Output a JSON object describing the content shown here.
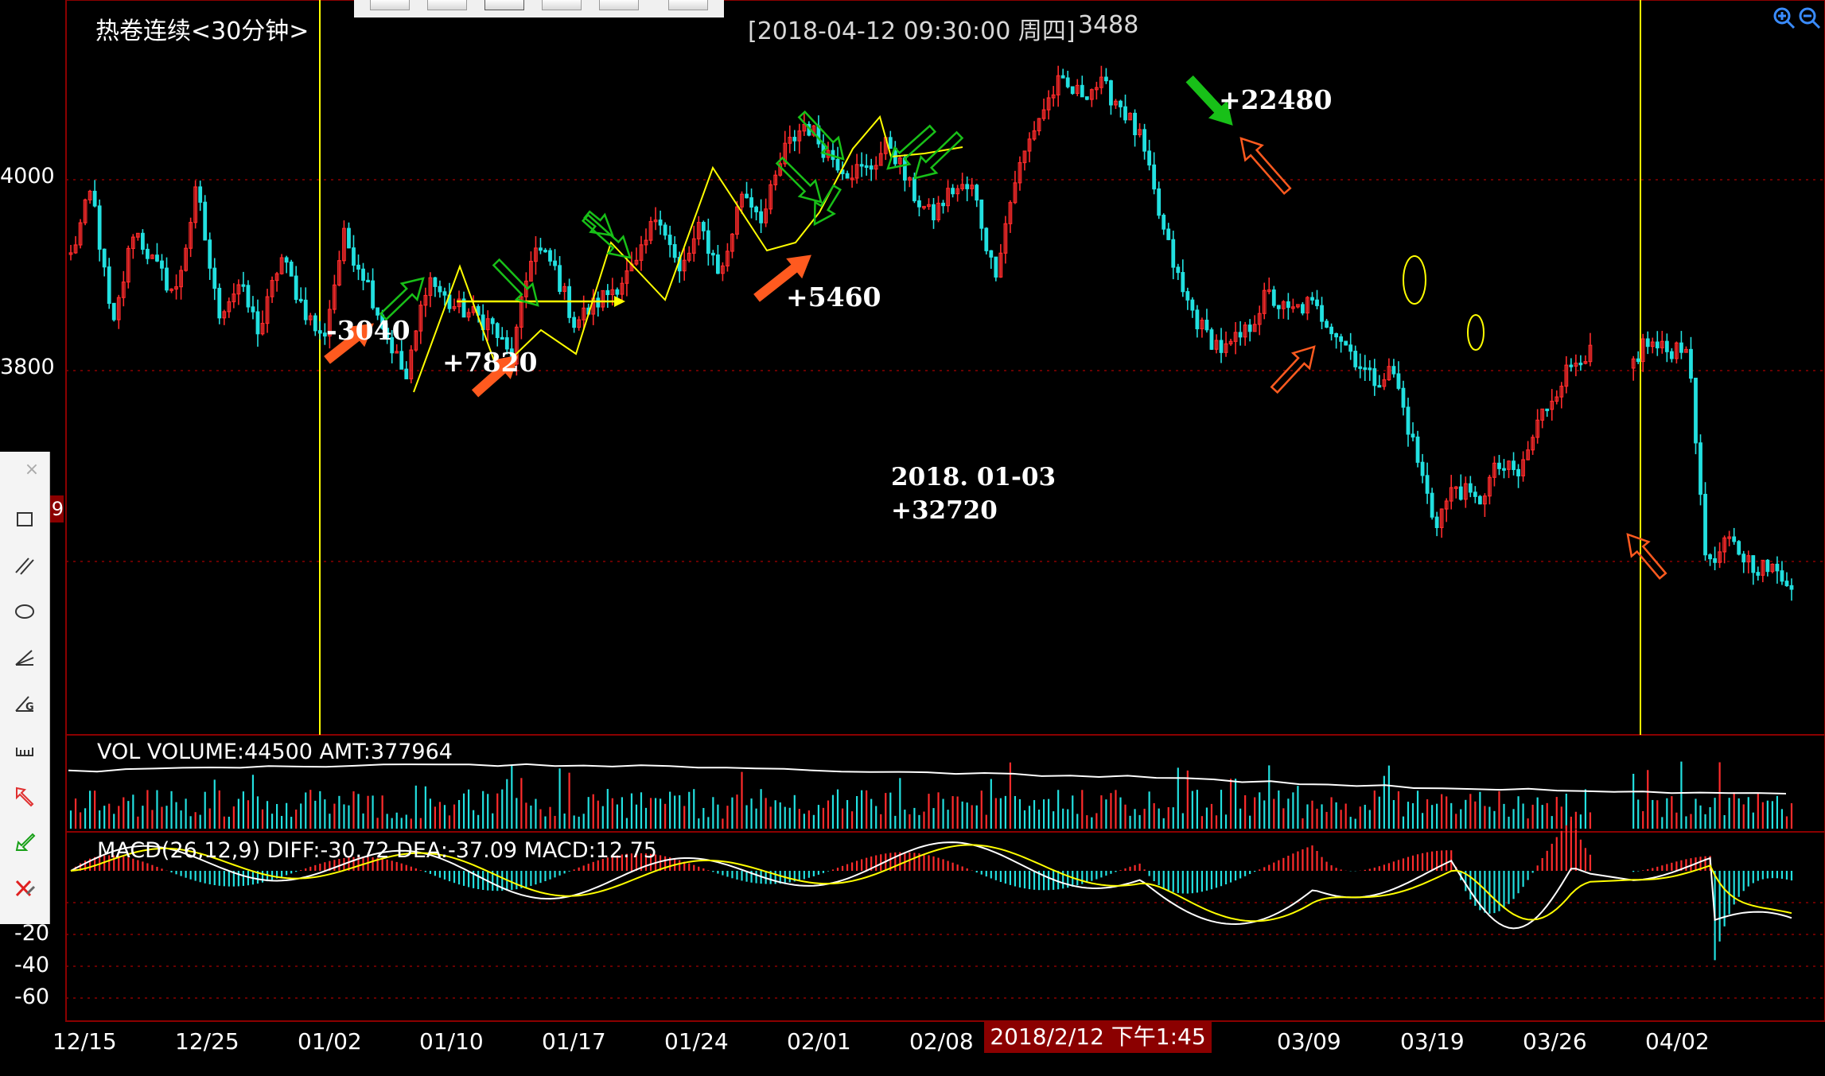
{
  "header": {
    "title": "热卷连续<30分钟>",
    "datetime": "[2018-04-12  09:30:00 周四]",
    "price": "3488"
  },
  "y_axis": {
    "main_ticks": [
      "4000",
      "3800"
    ],
    "macd_ticks": [
      "-20",
      "-40",
      "-60"
    ]
  },
  "x_axis": {
    "ticks": [
      "12/15",
      "12/25",
      "01/02",
      "01/10",
      "01/17",
      "01/24",
      "02/01",
      "02/08",
      "03/09",
      "03/19",
      "03/26",
      "04/02"
    ]
  },
  "crosshair_date": "2018/2/12 下午1:45",
  "vol_label": "VOL  VOLUME:44500 AMT:377964",
  "macd_label": "MACD(26,12,9)  DIFF:-30.72 DEA:-37.09 MACD:12.75",
  "annotations": {
    "a1": "-3040",
    "a2": "+7820",
    "a3": "+5460",
    "a4": "+22480",
    "note_date": "2018. 01-03",
    "note_total": "+32720"
  },
  "toolbox": {
    "close_label": "×",
    "side_value": "9"
  },
  "colors": {
    "up": "#ff2b2b",
    "down": "#22e0e0",
    "grid": "#8b0000",
    "yellow": "#ffff00",
    "green": "#18c018",
    "orange": "#ff5a1f"
  },
  "chart_data": {
    "type": "candlestick",
    "title": "热卷连续<30分钟>",
    "ylim": [
      3560,
      4170
    ],
    "x_ticks": [
      "12/15",
      "12/25",
      "01/02",
      "01/10",
      "01/17",
      "01/24",
      "02/01",
      "02/08",
      "03/09",
      "03/19",
      "03/26",
      "04/02"
    ],
    "price_path": [
      3920,
      3990,
      3840,
      3950,
      3910,
      3880,
      3990,
      3860,
      3890,
      3840,
      3920,
      3870,
      3830,
      3940,
      3900,
      3840,
      3790,
      3900,
      3870,
      3860,
      3850,
      3810,
      3930,
      3910,
      3850,
      3870,
      3890,
      3910,
      3970,
      3900,
      3950,
      3900,
      3990,
      3960,
      4030,
      4060,
      4030,
      4010,
      4010,
      4040,
      3990,
      3960,
      3990,
      3990,
      3900,
      4000,
      4060,
      4100,
      4090,
      4100,
      4080,
      4040,
      3950,
      3880,
      3840,
      3820,
      3840,
      3880,
      3860,
      3870,
      3850,
      3820,
      3790,
      3800,
      3720,
      3640,
      3680,
      3660,
      3700,
      3690,
      3750,
      3790,
      3820,
      3810,
      3790,
      3830,
      3820,
      3830,
      3590,
      3620,
      3600,
      3590,
      3580
    ],
    "events": [
      {
        "label": "-3040"
      },
      {
        "label": "+7820"
      },
      {
        "label": "+5460"
      },
      {
        "label": "+22480"
      }
    ],
    "vol": {
      "volume": 44500,
      "amt": 377964
    },
    "macd": {
      "params": "26,12,9",
      "diff": -30.72,
      "dea": -37.09,
      "macd": 12.75,
      "ylim": [
        -70,
        30
      ]
    }
  }
}
